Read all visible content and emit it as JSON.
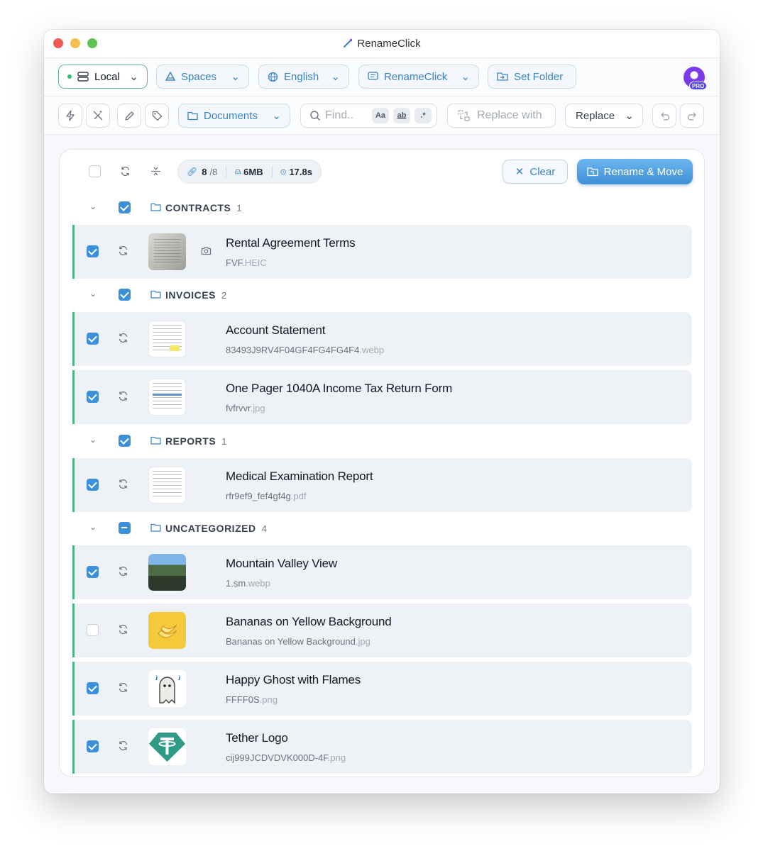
{
  "window": {
    "title": "RenameClick"
  },
  "toolbar1": {
    "local": "Local",
    "spaces": "Spaces",
    "language": "English",
    "preset": "RenameClick",
    "set_folder": "Set Folder",
    "pro_badge": "PRO"
  },
  "toolbar2": {
    "documents": "Documents",
    "find_placeholder": "Find..",
    "case_tag": "Aa",
    "word_tag": "ab",
    "regex_tag": ".*",
    "replace_placeholder": "Replace with",
    "replace_label": "Replace"
  },
  "summary": {
    "count_selected": "8",
    "count_total": "/8",
    "size": "6MB",
    "time": "17.8s",
    "clear_label": "Clear",
    "rename_label": "Rename & Move"
  },
  "groups": [
    {
      "name": "CONTRACTS",
      "count": "1",
      "state": "checked",
      "files": [
        {
          "title": "Rental Agreement Terms",
          "base": "FVF",
          "ext": ".HEIC",
          "checked": true
        }
      ]
    },
    {
      "name": "INVOICES",
      "count": "2",
      "state": "checked",
      "files": [
        {
          "title": "Account Statement",
          "base": "83493J9RV4F04GF4FG4FG4F4",
          "ext": ".webp",
          "checked": true
        },
        {
          "title": "One Pager 1040A Income Tax Return Form",
          "base": "fvfrvvr",
          "ext": ".jpg",
          "checked": true
        }
      ]
    },
    {
      "name": "REPORTS",
      "count": "1",
      "state": "checked",
      "files": [
        {
          "title": "Medical Examination Report",
          "base": "rfr9ef9_fef4gf4g",
          "ext": ".pdf",
          "checked": true
        }
      ]
    },
    {
      "name": "UNCATEGORIZED",
      "count": "4",
      "state": "partial",
      "files": [
        {
          "title": "Mountain Valley View",
          "base": "1.sm",
          "ext": ".webp",
          "checked": true
        },
        {
          "title": "Bananas on Yellow Background",
          "base": "Bananas on Yellow Background",
          "ext": ".jpg",
          "checked": false
        },
        {
          "title": "Happy Ghost with Flames",
          "base": "FFFF0S",
          "ext": ".png",
          "checked": true
        },
        {
          "title": "Tether Logo",
          "base": "cij999JCDVDVK000D-4F",
          "ext": ".png",
          "checked": true
        }
      ]
    }
  ],
  "colors": {
    "accent": "#3b8fdb",
    "row_bar": "#4cb584",
    "rename_button": "#4f9ee3"
  }
}
